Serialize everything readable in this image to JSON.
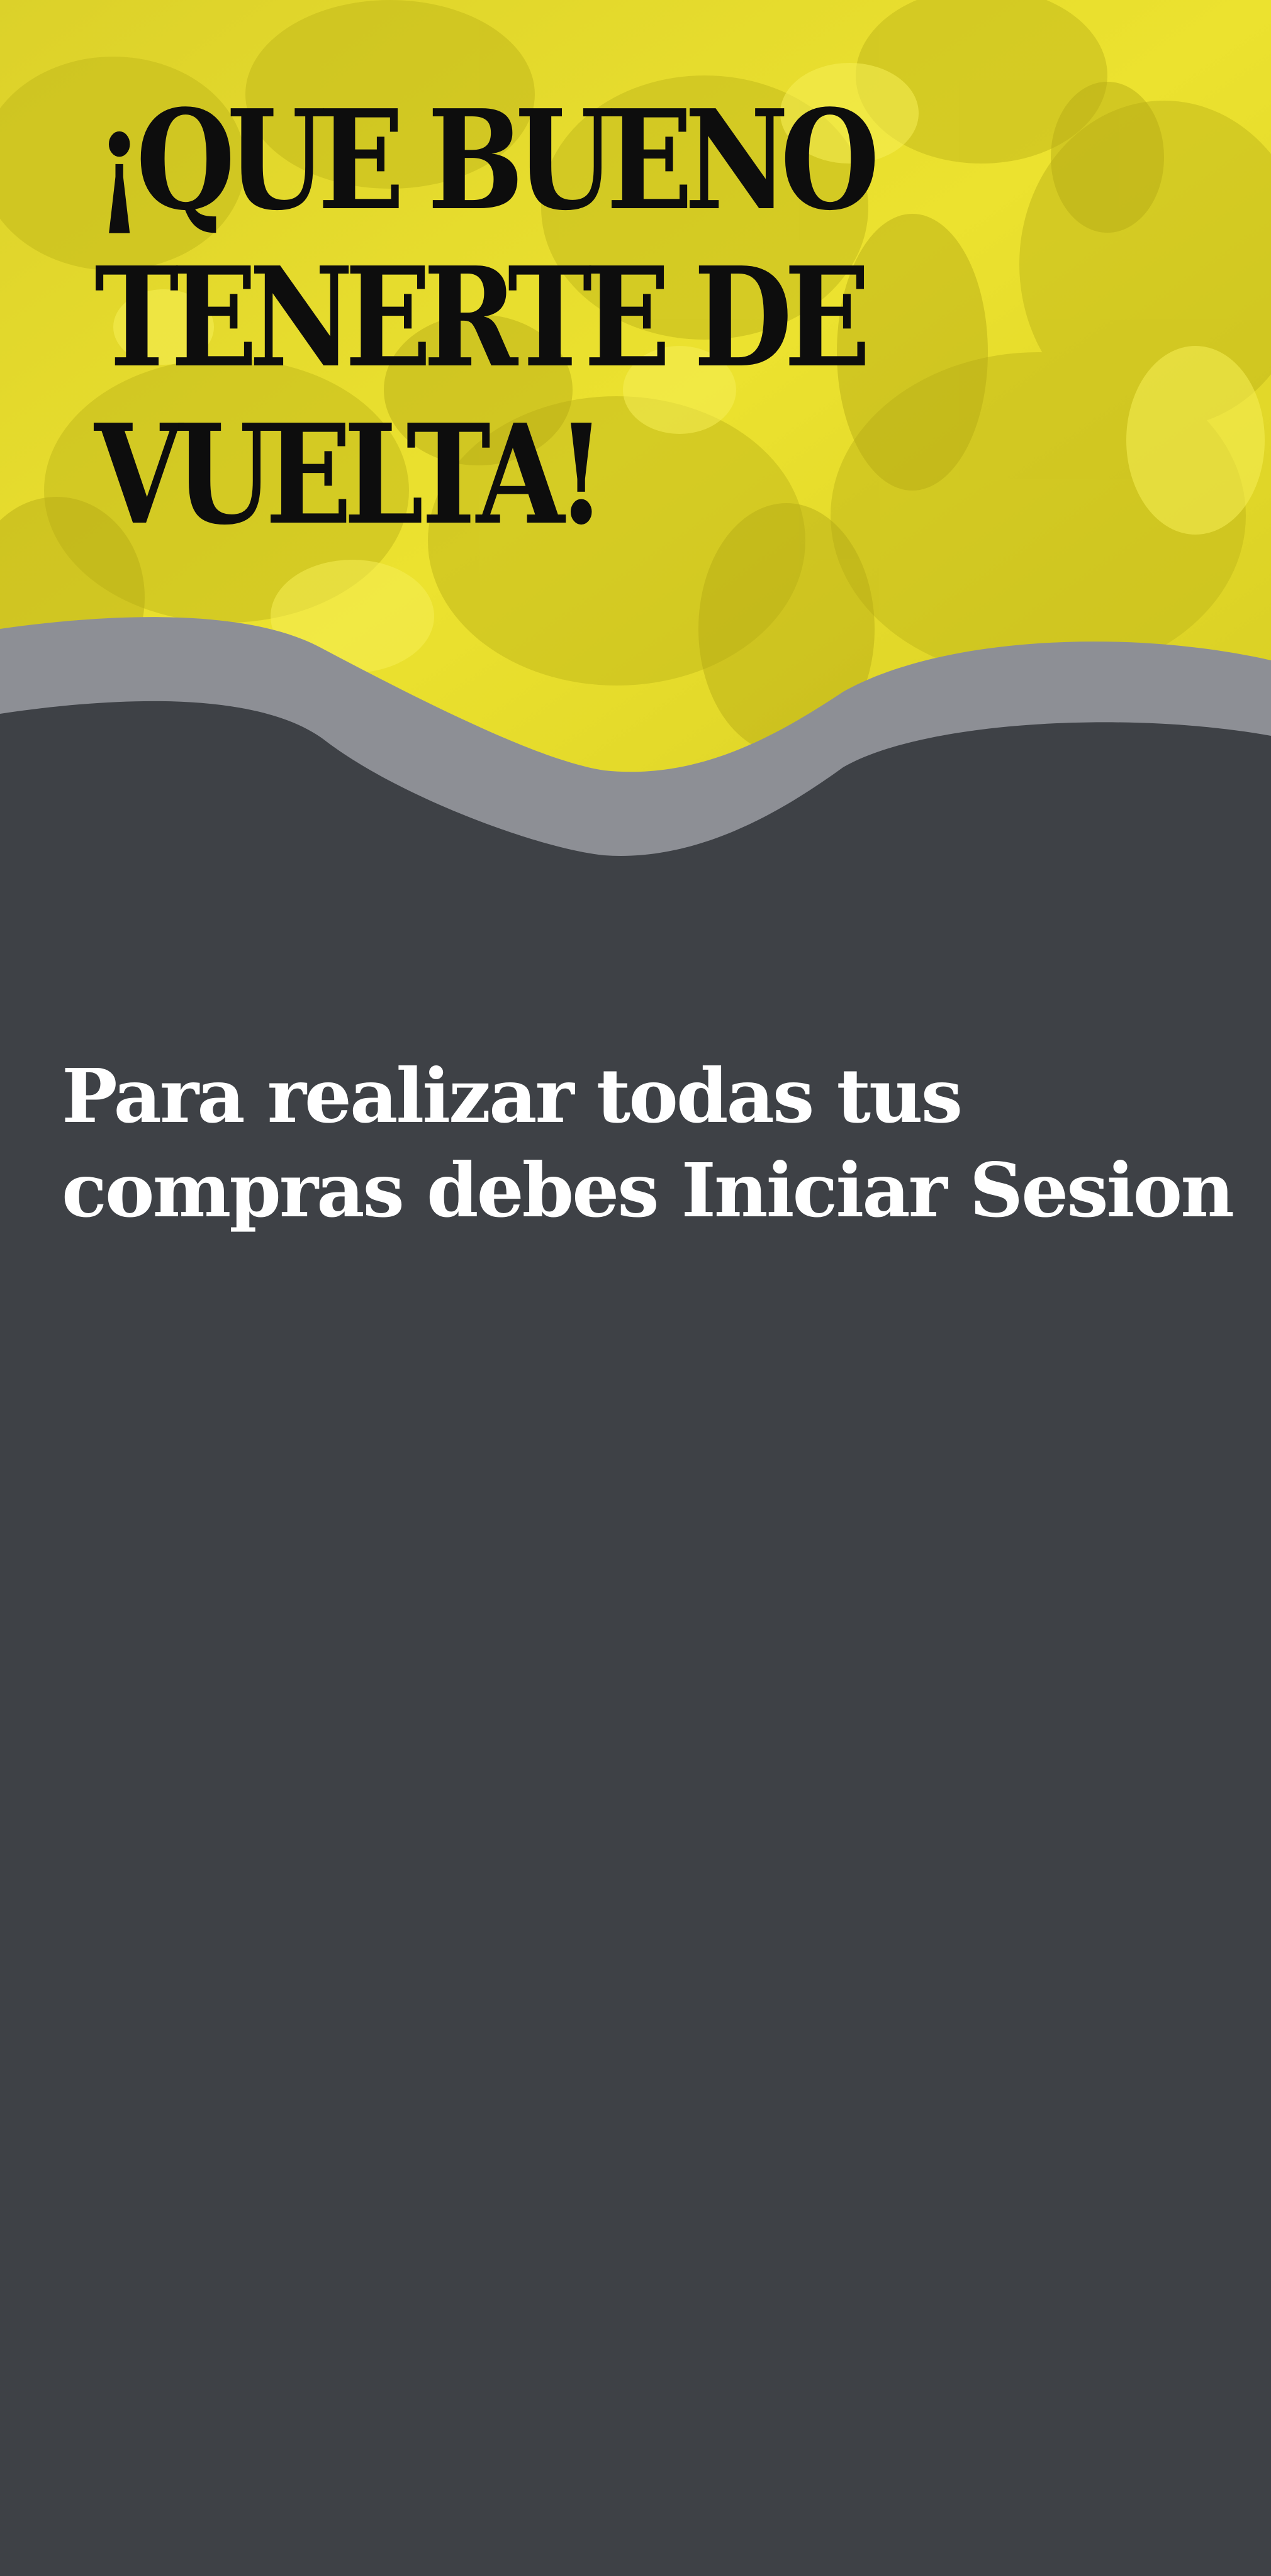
{
  "hero": {
    "headline_lines": [
      "¡QUE BUENO",
      "TENERTE DE",
      "VUELTA!"
    ],
    "background_image": "yellow-tinted-crowd-photo"
  },
  "message": {
    "lines": [
      "Para realizar todas tus",
      "compras debes Iniciar Sesion"
    ]
  },
  "colors": {
    "hero_yellow": "#e8de2e",
    "wave_gray": "#8d8f95",
    "panel_dark": "#3e4146",
    "headline_text": "#0d0d0d",
    "message_text": "#ffffff"
  }
}
